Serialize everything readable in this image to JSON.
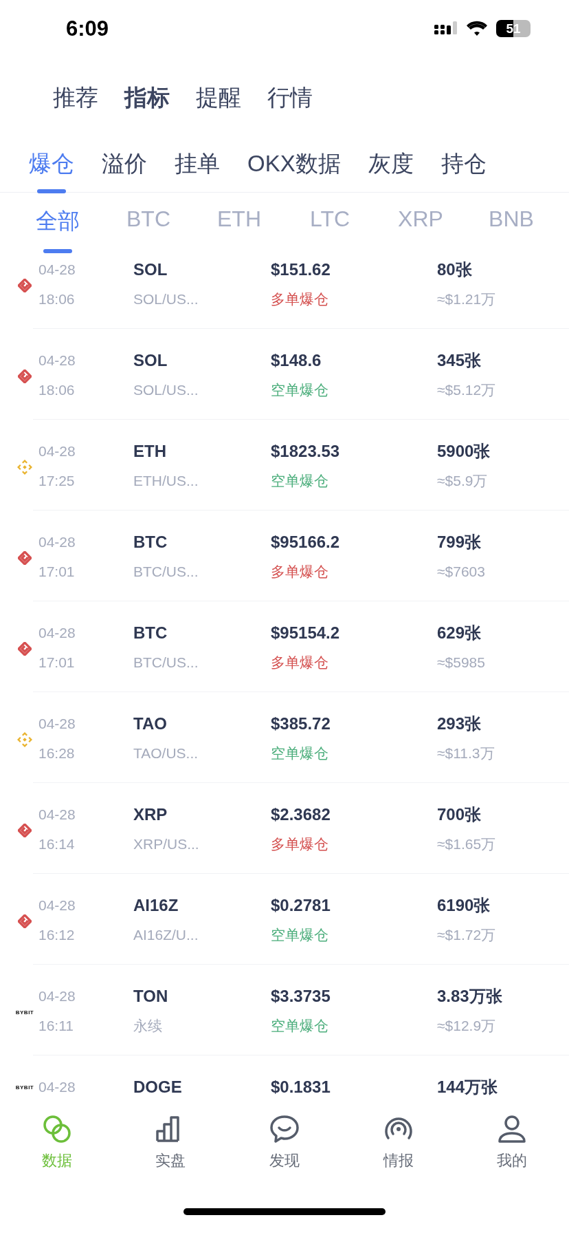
{
  "status_bar": {
    "time": "6:09",
    "battery": "51"
  },
  "top_tabs": [
    {
      "label": "推荐",
      "selected": false
    },
    {
      "label": "指标",
      "selected": true
    },
    {
      "label": "提醒",
      "selected": false
    },
    {
      "label": "行情",
      "selected": false
    }
  ],
  "sub_tabs": [
    {
      "label": "爆仓",
      "selected": true
    },
    {
      "label": "溢价",
      "selected": false
    },
    {
      "label": "挂单",
      "selected": false
    },
    {
      "label": "OKX数据",
      "selected": false
    },
    {
      "label": "灰度",
      "selected": false
    },
    {
      "label": "持仓",
      "selected": false
    }
  ],
  "coin_tabs": [
    {
      "label": "全部",
      "selected": true
    },
    {
      "label": "BTC",
      "selected": false
    },
    {
      "label": "ETH",
      "selected": false
    },
    {
      "label": "LTC",
      "selected": false
    },
    {
      "label": "XRP",
      "selected": false
    },
    {
      "label": "BNB",
      "selected": false
    }
  ],
  "rows": [
    {
      "kind": "gate",
      "date": "04-28",
      "time": "18:06",
      "symbol": "SOL",
      "pair": "SOL/US...",
      "price": "$151.62",
      "side": {
        "kind": "long",
        "label": "多单爆仓"
      },
      "qty": "80张",
      "usd": "≈$1.21万"
    },
    {
      "kind": "gate",
      "date": "04-28",
      "time": "18:06",
      "symbol": "SOL",
      "pair": "SOL/US...",
      "price": "$148.6",
      "side": {
        "kind": "short",
        "label": "空单爆仓"
      },
      "qty": "345张",
      "usd": "≈$5.12万"
    },
    {
      "kind": "binance",
      "date": "04-28",
      "time": "17:25",
      "symbol": "ETH",
      "pair": "ETH/US...",
      "price": "$1823.53",
      "side": {
        "kind": "short",
        "label": "空单爆仓"
      },
      "qty": "5900张",
      "usd": "≈$5.9万"
    },
    {
      "kind": "gate",
      "date": "04-28",
      "time": "17:01",
      "symbol": "BTC",
      "pair": "BTC/US...",
      "price": "$95166.2",
      "side": {
        "kind": "long",
        "label": "多单爆仓"
      },
      "qty": "799张",
      "usd": "≈$7603"
    },
    {
      "kind": "gate",
      "date": "04-28",
      "time": "17:01",
      "symbol": "BTC",
      "pair": "BTC/US...",
      "price": "$95154.2",
      "side": {
        "kind": "long",
        "label": "多单爆仓"
      },
      "qty": "629张",
      "usd": "≈$5985"
    },
    {
      "kind": "binance",
      "date": "04-28",
      "time": "16:28",
      "symbol": "TAO",
      "pair": "TAO/US...",
      "price": "$385.72",
      "side": {
        "kind": "short",
        "label": "空单爆仓"
      },
      "qty": "293张",
      "usd": "≈$11.3万"
    },
    {
      "kind": "gate",
      "date": "04-28",
      "time": "16:14",
      "symbol": "XRP",
      "pair": "XRP/US...",
      "price": "$2.3682",
      "side": {
        "kind": "long",
        "label": "多单爆仓"
      },
      "qty": "700张",
      "usd": "≈$1.65万"
    },
    {
      "kind": "gate",
      "date": "04-28",
      "time": "16:12",
      "symbol": "AI16Z",
      "pair": "AI16Z/U...",
      "price": "$0.2781",
      "side": {
        "kind": "short",
        "label": "空单爆仓"
      },
      "qty": "6190张",
      "usd": "≈$1.72万"
    },
    {
      "kind": "bybit",
      "logo_text": "BYBIT",
      "date": "04-28",
      "time": "16:11",
      "symbol": "TON",
      "pair": "永续",
      "price": "$3.3735",
      "side": {
        "kind": "short",
        "label": "空单爆仓"
      },
      "qty": "3.83万张",
      "usd": "≈$12.9万"
    },
    {
      "kind": "bybit",
      "logo_text": "BYBIT",
      "date": "04-28",
      "symbol": "DOGE",
      "price": "$0.1831",
      "qty": "144万张"
    }
  ],
  "bottom_tabs": [
    {
      "kind": "rings",
      "label": "数据",
      "selected": true
    },
    {
      "kind": "bars",
      "label": "实盘",
      "selected": false
    },
    {
      "kind": "chat",
      "label": "发现",
      "selected": false
    },
    {
      "kind": "signal",
      "label": "情报",
      "selected": false
    },
    {
      "kind": "person",
      "label": "我的",
      "selected": false
    }
  ]
}
